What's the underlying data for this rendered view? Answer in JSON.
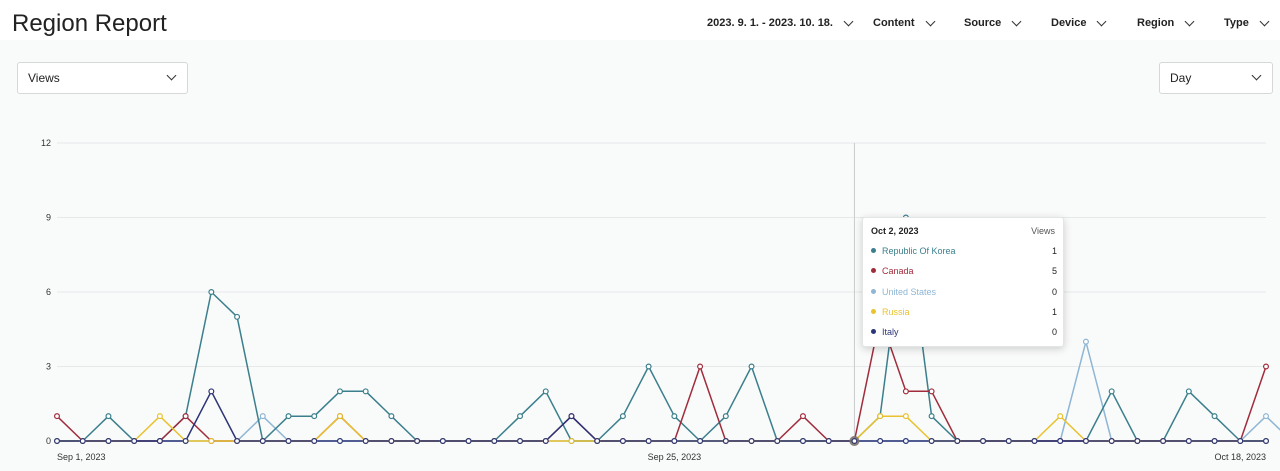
{
  "page": {
    "title": "Region Report",
    "filters": [
      "2023. 9. 1. - 2023. 10. 18.",
      "Content",
      "Source",
      "Device",
      "Region",
      "Type"
    ],
    "metric_select": "Views",
    "interval_select": "Day"
  },
  "tooltip": {
    "date": "Oct 2, 2023",
    "metric": "Views",
    "rows": [
      {
        "name": "Republic Of Korea",
        "value": "1",
        "color": "#3b7f8c"
      },
      {
        "name": "Canada",
        "value": "5",
        "color": "#a02c3c"
      },
      {
        "name": "United States",
        "value": "0",
        "color": "#8fb6d4"
      },
      {
        "name": "Russia",
        "value": "1",
        "color": "#e9c22f"
      },
      {
        "name": "Italy",
        "value": "0",
        "color": "#2b3476"
      }
    ]
  },
  "chart_data": {
    "type": "line",
    "x_tick_labels": [
      "Sep 1, 2023",
      "Sep 25, 2023",
      "Oct 18, 2023"
    ],
    "x_tick_index": [
      0,
      24,
      47
    ],
    "ylim": [
      0,
      12
    ],
    "y_ticks": [
      0,
      3,
      6,
      9,
      12
    ],
    "grid": true,
    "hover_index": 31,
    "series": [
      {
        "name": "Republic Of Korea",
        "color": "#3b7f8c",
        "values": [
          0,
          0,
          1,
          0,
          0,
          1,
          6,
          5,
          0,
          1,
          1,
          2,
          2,
          1,
          0,
          0,
          0,
          0,
          1,
          2,
          0,
          0,
          1,
          3,
          1,
          0,
          1,
          3,
          0,
          0,
          0,
          0,
          1,
          9,
          1,
          0,
          0,
          0,
          0,
          0,
          0,
          2,
          0,
          0,
          2,
          1,
          0,
          0
        ]
      },
      {
        "name": "Canada",
        "color": "#a02c3c",
        "values": [
          1,
          0,
          0,
          0,
          0,
          1,
          0,
          0,
          0,
          0,
          0,
          1,
          0,
          0,
          0,
          0,
          0,
          0,
          0,
          0,
          1,
          0,
          0,
          0,
          0,
          3,
          0,
          0,
          0,
          1,
          0,
          0,
          5,
          2,
          2,
          0,
          0,
          0,
          0,
          0,
          0,
          0,
          0,
          0,
          0,
          0,
          0,
          3
        ]
      },
      {
        "name": "United States",
        "color": "#8fb6d4",
        "values": [
          0,
          0,
          0,
          0,
          0,
          0,
          0,
          0,
          1,
          0,
          0,
          0,
          0,
          0,
          0,
          0,
          0,
          0,
          0,
          0,
          0,
          0,
          0,
          0,
          0,
          0,
          0,
          0,
          0,
          0,
          0,
          0,
          0,
          0,
          0,
          0,
          0,
          0,
          0,
          0,
          4,
          0,
          0,
          0,
          0,
          0,
          0,
          1,
          0
        ]
      },
      {
        "name": "Russia",
        "color": "#e9c22f",
        "values": [
          0,
          0,
          0,
          0,
          1,
          0,
          0,
          0,
          0,
          0,
          0,
          1,
          0,
          0,
          0,
          0,
          0,
          0,
          0,
          0,
          0,
          0,
          0,
          0,
          0,
          0,
          0,
          0,
          0,
          0,
          0,
          0,
          1,
          1,
          0,
          0,
          0,
          0,
          0,
          1,
          0,
          0,
          0,
          0,
          0,
          0,
          0,
          0
        ]
      },
      {
        "name": "Italy",
        "color": "#2b3476",
        "values": [
          0,
          0,
          0,
          0,
          0,
          0,
          2,
          0,
          0,
          0,
          0,
          0,
          0,
          0,
          0,
          0,
          0,
          0,
          0,
          0,
          1,
          0,
          0,
          0,
          0,
          0,
          0,
          0,
          0,
          0,
          0,
          0,
          0,
          0,
          0,
          0,
          0,
          0,
          0,
          0,
          0,
          0,
          0,
          0,
          0,
          0,
          0,
          0
        ]
      }
    ]
  }
}
